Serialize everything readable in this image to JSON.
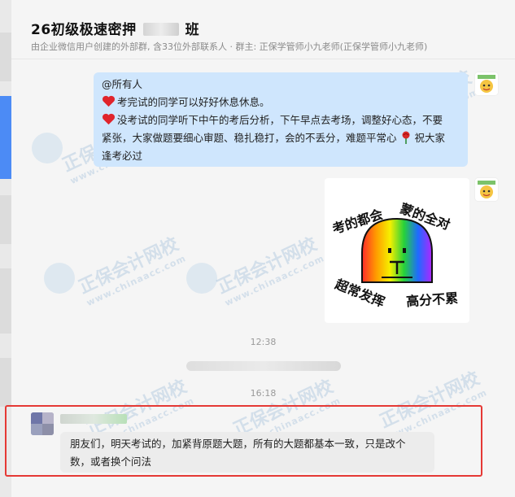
{
  "header": {
    "title_prefix": "26初级极速密押",
    "title_suffix": "班",
    "subtitle": "由企业微信用户创建的外部群, 含33位外部联系人 · 群主: 正保学管师小九老师(正保学管师小九老师)"
  },
  "messages": {
    "announcement": {
      "mention": "@所有人",
      "line1": "考完试的同学可以好好休息休息。",
      "line2a": "没考试的同学听下中午的考后分析，下午早点去考场，调整好心态，不要",
      "line2b": "紧张，大家做题要细心审题、稳扎稳打，会的不丢分，难题平常心",
      "line2c": "祝大家",
      "line2d": "逢考必过"
    },
    "sticker": {
      "top_left": "考的都会",
      "top_right": "蒙的全对",
      "bottom_left": "超常发挥",
      "bottom_right": "高分不累"
    },
    "time1": "12:38",
    "time2": "16:18",
    "reply": {
      "line1": "朋友们，明天考试的，加紧背原题大题，所有的大题都基本一致，只是改个",
      "line2": "数，或者换个问法"
    }
  },
  "watermark": {
    "text": "正保会计网校",
    "url": "www.chinaacc.com"
  },
  "colors": {
    "bubble_blue": "#cfe6fd",
    "highlight_red": "#e53935",
    "heart_red": "#e0242c"
  }
}
